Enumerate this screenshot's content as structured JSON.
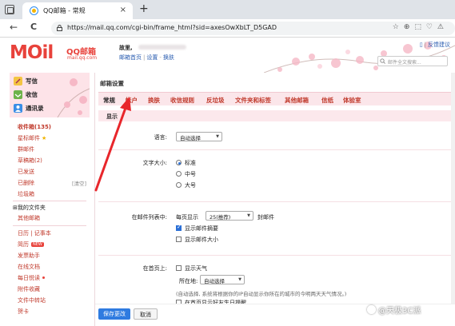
{
  "browser": {
    "tab_title": "QQ邮箱 - 常规",
    "tab_close": "×",
    "new_tab": "+",
    "url": "https://mail.qq.com/cgi-bin/frame_html?sid=axesOwXbLT_D5GAD",
    "back": "←",
    "reload": "C"
  },
  "header": {
    "logo_text": "MOil",
    "logo_cn": "QQ邮箱",
    "logo_domain": "mail.qq.com",
    "greeting": "故里,",
    "links": [
      "邮箱首页",
      "设置",
      "换肤"
    ],
    "top_right": "反馈建议",
    "search_placeholder": "邮件全文搜索..."
  },
  "sidebar": {
    "actions": [
      "写信",
      "收信",
      "通讯录"
    ],
    "folders": [
      {
        "label": "收件箱(135)"
      },
      {
        "label": "星标邮件"
      },
      {
        "label": "群邮件"
      },
      {
        "label": "草稿箱(2)"
      },
      {
        "label": "已发送"
      },
      {
        "label": "已删除"
      },
      {
        "label": "垃圾箱"
      }
    ],
    "clear_label": "[清空]",
    "my_folders": "我的文件夹",
    "other_mailbox": "其他邮箱",
    "apps": [
      {
        "label": "日历 | 记事本"
      },
      {
        "label": "简历"
      },
      {
        "label": "发票助手"
      },
      {
        "label": "在线文档"
      },
      {
        "label": "每日悦读"
      },
      {
        "label": "附件收藏"
      },
      {
        "label": "文件中转站"
      },
      {
        "label": "贺卡"
      }
    ],
    "new_badge": "NEW"
  },
  "settings": {
    "title": "邮箱设置",
    "tabs": [
      "常规",
      "帐户",
      "换肤",
      "收信规则",
      "反垃圾",
      "文件夹和标签",
      "其他邮箱",
      "信纸",
      "体验室"
    ],
    "active_tab": "常规",
    "section": "显示",
    "language_label": "语言:",
    "language_value": "自动选择",
    "font_size_label": "文字大小:",
    "font_sizes": [
      "标准",
      "中号",
      "大号"
    ],
    "list_label": "在邮件列表中:",
    "per_page_prefix": "每页显示",
    "per_page_value": "25(推荐)",
    "per_page_suffix": "封邮件",
    "show_summary": "显示邮件摘要",
    "show_size": "显示邮件大小",
    "home_label": "在首页上:",
    "show_weather": "显示天气",
    "location_label": "所在地:",
    "location_value": "自动选择",
    "location_hint": "(自动选择, 系统将根据你的IP自动显示你所在的城市的今明两天天气情况。)",
    "show_cut": "在首页显示好友生日提醒",
    "save_button": "保存更改",
    "cancel_button": "取消"
  },
  "watermark": "@天极3C派"
}
